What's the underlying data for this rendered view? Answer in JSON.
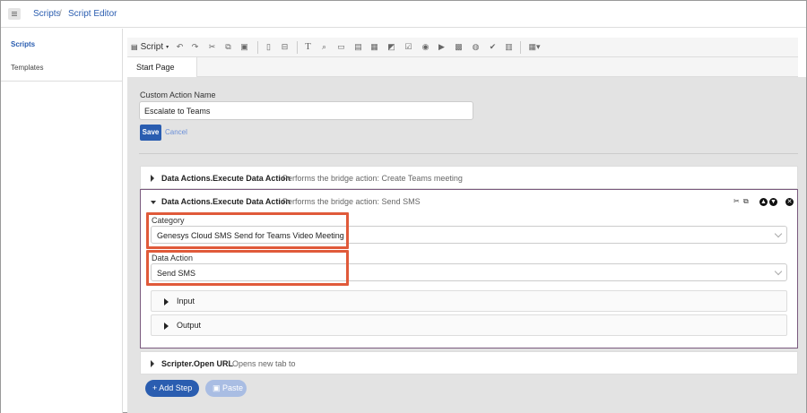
{
  "breadcrumb": {
    "scripts": "Scripts",
    "separator": "/",
    "editor": "Script Editor"
  },
  "sidebar": {
    "items": [
      {
        "label": "Scripts",
        "active": true
      },
      {
        "label": "Templates",
        "active": false
      }
    ]
  },
  "toolbar": {
    "script_menu": "Script",
    "icons": [
      "undo-icon",
      "redo-icon",
      "cut-icon",
      "copy-icon",
      "paste-icon",
      "input-icon",
      "collapse-icon",
      "text-icon",
      "search-icon",
      "textbox-icon",
      "list-icon",
      "calendar-icon",
      "image-icon",
      "checkbox-icon",
      "radio-icon",
      "play-icon",
      "picture-icon",
      "globe-icon",
      "check-icon",
      "table-icon",
      "grid-dropdown-icon"
    ]
  },
  "tabs": [
    {
      "label": "Start Page"
    }
  ],
  "form": {
    "name_label": "Custom Action Name",
    "name_value": "Escalate to Teams",
    "save_label": "Save",
    "cancel_label": "Cancel"
  },
  "actions": [
    {
      "title": "Data Actions.Execute Data Action",
      "description": "Performs the bridge action: Create Teams meeting"
    },
    {
      "title": "Data Actions.Execute Data Action",
      "description": "Performs the bridge action: Send SMS",
      "category_label": "Category",
      "category_value": "Genesys Cloud SMS Send for Teams Video Meeting",
      "data_action_label": "Data Action",
      "data_action_value": "Send SMS",
      "input_label": "Input",
      "output_label": "Output"
    },
    {
      "title": "Scripter.Open URL",
      "description": "Opens new tab to"
    }
  ],
  "buttons": {
    "add_step": "+ Add Step",
    "paste": "Paste"
  },
  "colors": {
    "accent": "#2a5db0",
    "highlight": "#e05a3a",
    "selected_border": "#7a5a7e"
  }
}
